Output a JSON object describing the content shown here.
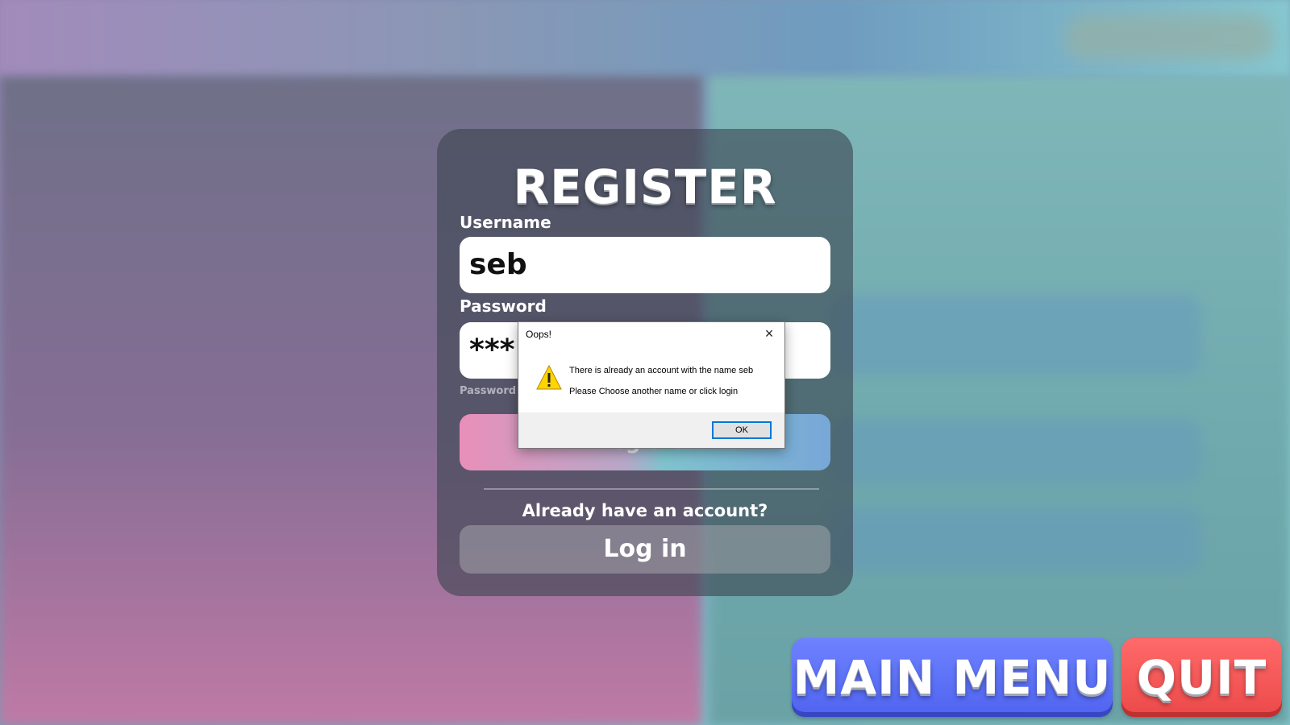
{
  "register": {
    "title": "REGISTER",
    "username_label": "Username",
    "username_value": "seb",
    "password_label": "Password",
    "password_value": "***",
    "hint_text": "Password m",
    "register_button": "Register",
    "already_text": "Already have an account?",
    "login_button": "Log in"
  },
  "dialog": {
    "title": "Oops!",
    "close_icon": "×",
    "message_line1": "There is already an account with the name seb",
    "message_line2": "Please Choose another name or click login",
    "ok_button": "OK",
    "icon": "warning-icon"
  },
  "footer": {
    "main_menu_button": "MAIN MENU",
    "quit_button": "QUIT"
  },
  "colors": {
    "main_menu": "#5b6ef7",
    "quit": "#f25555",
    "dialog_accent": "#0078d7"
  }
}
